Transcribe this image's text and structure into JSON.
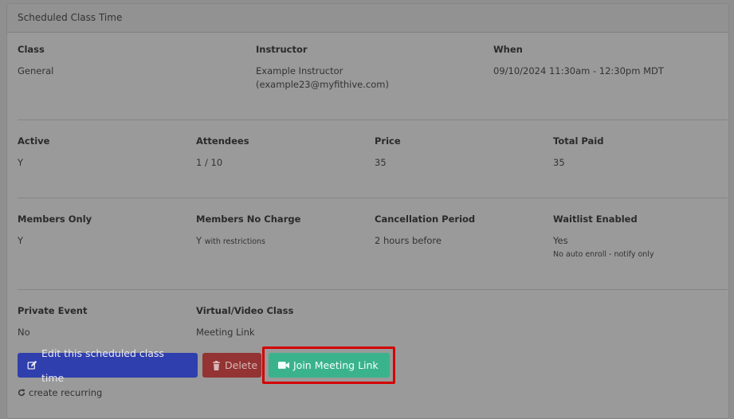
{
  "panel": {
    "title": "Scheduled Class Time"
  },
  "row1": [
    {
      "label": "Class",
      "value": "General"
    },
    {
      "label": "Instructor",
      "value": "Example Instructor",
      "value2": "(example23@myfithive.com)"
    },
    {
      "label": "When",
      "value": "09/10/2024 11:30am - 12:30pm MDT"
    }
  ],
  "row2": [
    {
      "label": "Active",
      "value": "Y"
    },
    {
      "label": "Attendees",
      "value": "1 / 10"
    },
    {
      "label": "Price",
      "value": "35"
    },
    {
      "label": "Total Paid",
      "value": "35"
    }
  ],
  "row3": [
    {
      "label": "Members Only",
      "value": "Y"
    },
    {
      "label": "Members No Charge",
      "value": "Y",
      "note": "with restrictions"
    },
    {
      "label": "Cancellation Period",
      "value": "2 hours before"
    },
    {
      "label": "Waitlist Enabled",
      "value": "Yes",
      "note": "No auto enroll - notify only"
    }
  ],
  "row4": [
    {
      "label": "Private Event",
      "value": "No"
    },
    {
      "label": "Virtual/Video Class",
      "value": "Meeting Link"
    }
  ],
  "actions": {
    "edit_label": "Edit this scheduled class time",
    "delete_label": "Delete",
    "join_label": "Join Meeting Link",
    "recurring_label": "create recurring"
  },
  "icons": {
    "edit": "edit-icon",
    "delete": "trash-icon",
    "join": "video-camera-icon",
    "recurring": "refresh-icon"
  },
  "colors": {
    "edit_button": "#2f3fae",
    "delete_button": "#933333",
    "join_button": "#3ab38c",
    "highlight": "#d40000"
  }
}
